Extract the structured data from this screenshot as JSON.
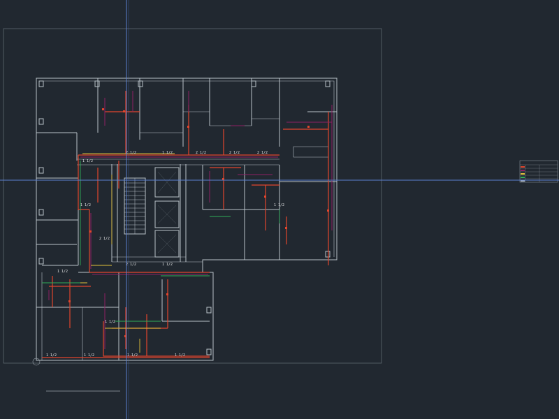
{
  "drawing": {
    "background": "#212830",
    "wall_color": "#b9c2c9",
    "pipe_colors": {
      "hot": "#e2452c",
      "cold": "#8f1f63",
      "yellow": "#e3c23a",
      "green": "#2fae58"
    },
    "crosshair_color": "#5b7fd1"
  },
  "pipe_labels": [
    "1 1/2",
    "2 1/2",
    "1 1/2",
    "2 1/2",
    "2 1/2",
    "2 1/2",
    "2 1/2",
    "1 1/2",
    "2 1/2",
    "1 1/2",
    "1 1/2",
    "1 1/2",
    "1 1/2",
    "1 1/2",
    "1 1/2",
    "1 1/2",
    "1 1/2"
  ],
  "legend_table": {
    "title": "",
    "rows": [
      "",
      "",
      "",
      "",
      ""
    ]
  }
}
